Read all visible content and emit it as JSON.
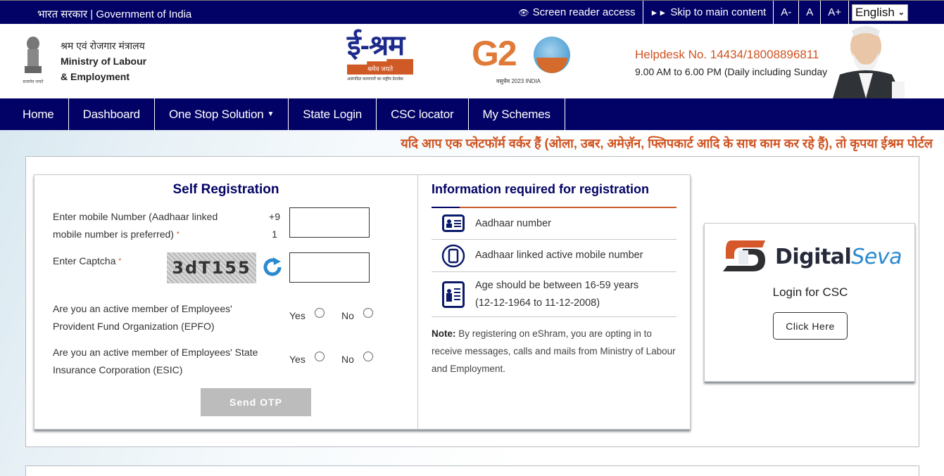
{
  "topbar": {
    "gov_label": "भारत सरकार | Government of India",
    "screen_reader": "Screen reader access",
    "skip_main": "Skip to main content",
    "font_decrease": "A-",
    "font_normal": "A",
    "font_increase": "A+",
    "language_selected": "English"
  },
  "header": {
    "ministry_hindi": "श्रम एवं रोजगार मंत्रालय",
    "ministry_line1": "Ministry of Labour",
    "ministry_line2": "& Employment",
    "emblem_motto": "सत्यमेव जयते",
    "eshram_logo": "ई-श्रम",
    "eshram_tagline": "श्रमेव जयते",
    "eshram_subtitle": "असंगठित कामगारों का राष्ट्रीय डेटाबेस",
    "g20_logo": "G2",
    "g20_subtitle": "वसुधैव 2023 INDIA",
    "helpdesk_number": "Helpdesk No. 14434/18008896811",
    "helpdesk_hours": "9.00 AM to 6.00 PM (Daily including Sunday)"
  },
  "nav": {
    "items": [
      "Home",
      "Dashboard",
      "One Stop Solution",
      "State Login",
      "CSC locator",
      "My Schemes"
    ]
  },
  "marquee_text": "यदि आप एक प्लेटफॉर्म वर्कर हैं (ओला, उबर, अमेज़ॅन, फ्लिपकार्ट आदि के साथ काम कर रहे हैं), तो कृपया ईश्रम पोर्टल",
  "self_registration": {
    "title": "Self Registration",
    "mobile_label_line1": "Enter mobile Number (Aadhaar linked",
    "mobile_label_line2": "mobile number is preferred)",
    "country_code_line1": "+9",
    "country_code_line2": "1",
    "mobile_value": "",
    "captcha_label": "Enter Captcha",
    "captcha_text": "3dT155",
    "captcha_value": "",
    "required_mark": "*",
    "epfo_question_line1": "Are you an active member of Employees'",
    "epfo_question_line2": "Provident Fund Organization (EPFO)",
    "esic_question_line1": "Are you an active member of Employees' State",
    "esic_question_line2": "Insurance Corporation (ESIC)",
    "yes_label": "Yes",
    "no_label": "No",
    "send_otp": "Send OTP"
  },
  "info": {
    "title": "Information required for registration",
    "items": [
      {
        "icon": "id-card-icon",
        "text_line1": "Aadhaar number",
        "text_line2": ""
      },
      {
        "icon": "mobile-phone-icon",
        "text_line1": "Aadhaar linked active mobile number",
        "text_line2": ""
      },
      {
        "icon": "age-card-icon",
        "text_line1": "Age should be between 16-59 years",
        "text_line2": "(12-12-1964 to 11-12-2008)"
      }
    ],
    "note_label": "Note:",
    "note_text": " By registering on eShram, you are opting in to receive messages, calls and mails from Ministry of Labour and Employment."
  },
  "csc": {
    "brand_main": "Digital",
    "brand_accent": "Seva",
    "login_label": "Login for CSC",
    "button_label": "Click Here"
  },
  "colors": {
    "navy": "#020266",
    "orange": "#d0521f",
    "seva_blue": "#2a8ad0"
  }
}
